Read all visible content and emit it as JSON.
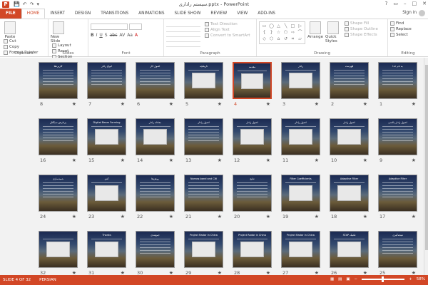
{
  "window": {
    "app_icon_letter": "P",
    "title": "سیستم راداری.pptx - PowerPoint",
    "controls": [
      "?",
      "▭",
      "–",
      "□",
      "✕"
    ]
  },
  "qat": [
    "💾",
    "↶",
    "↷",
    "▾"
  ],
  "tabs": [
    {
      "label": "FILE",
      "kind": "file"
    },
    {
      "label": "HOME",
      "kind": "active"
    },
    {
      "label": "INSERT"
    },
    {
      "label": "DESIGN"
    },
    {
      "label": "TRANSITIONS"
    },
    {
      "label": "ANIMATIONS"
    },
    {
      "label": "SLIDE SHOW"
    },
    {
      "label": "REVIEW"
    },
    {
      "label": "VIEW"
    },
    {
      "label": "ADD-INS"
    }
  ],
  "signin": "Sign in",
  "ribbon": {
    "clipboard": {
      "label": "Clipboard",
      "paste": "Paste",
      "cut": "Cut",
      "copy": "Copy",
      "format_painter": "Format Painter"
    },
    "slides": {
      "label": "Slides",
      "new_slide": "New Slide",
      "layout": "Layout",
      "reset": "Reset",
      "section": "Section"
    },
    "font": {
      "label": "Font",
      "format_glyphs": [
        "B",
        "I",
        "U",
        "S",
        "abc",
        "AV",
        "Aa",
        "A"
      ]
    },
    "paragraph": {
      "label": "Paragraph",
      "text_direction": "Text Direction",
      "align_text": "Align Text",
      "convert_smartart": "Convert to SmartArt"
    },
    "drawing": {
      "label": "Drawing",
      "arrange": "Arrange",
      "quick_styles": "Quick Styles",
      "shape_fill": "Shape Fill",
      "shape_outline": "Shape Outline",
      "shape_effects": "Shape Effects",
      "shapes": [
        "▭",
        "◯",
        "△",
        "╲",
        "□",
        "▷",
        "{",
        "}",
        "☆",
        "⬠",
        "⇨",
        "⌒",
        "◇",
        "⬡",
        "⌂",
        "↺",
        "⌗",
        "▱"
      ]
    },
    "editing": {
      "label": "Editing",
      "find": "Find",
      "replace": "Replace",
      "select": "Select"
    }
  },
  "slides": [
    {
      "n": 1,
      "title": "به نام خدا"
    },
    {
      "n": 2,
      "title": "فهرست"
    },
    {
      "n": 3,
      "title": "رادار",
      "pic": true
    },
    {
      "n": 4,
      "title": "مقدمه",
      "pic": true,
      "selected": true
    },
    {
      "n": 5,
      "title": "تاریخچه",
      "pic": true
    },
    {
      "n": 6,
      "title": "اصول کار"
    },
    {
      "n": 7,
      "title": "انواع رادار"
    },
    {
      "n": 8,
      "title": "کاربردها"
    },
    {
      "n": 9,
      "title": "اصول رادار پالسی"
    },
    {
      "n": 10,
      "title": "اصول رادار",
      "pic": true
    },
    {
      "n": 11,
      "title": "اصول رادار",
      "pic": true
    },
    {
      "n": 12,
      "title": "اصول رادار",
      "pic": true
    },
    {
      "n": 13,
      "title": "اصول رادار"
    },
    {
      "n": 14,
      "title": "معادله رادار",
      "pic": true
    },
    {
      "n": 15,
      "title": "Digital Beam Forming",
      "pic": true
    },
    {
      "n": 16,
      "title": "پردازش سیگنال"
    },
    {
      "n": 17,
      "title": "Adaptive Filter"
    },
    {
      "n": 18,
      "title": "Adaptive Filter",
      "pic": true
    },
    {
      "n": 19,
      "title": "Filter Coefficients",
      "pic": true
    },
    {
      "n": 20,
      "title": "نتایج"
    },
    {
      "n": 21,
      "title": "Narrow-band and CW"
    },
    {
      "n": 22,
      "title": "روش‌ها"
    },
    {
      "n": 23,
      "title": "آنتن",
      "pic": true
    },
    {
      "n": 24,
      "title": "شبیه‌سازی"
    },
    {
      "n": 25,
      "title": "نتیجه‌گیری"
    },
    {
      "n": 26,
      "title": "تکنیک STAP",
      "pic": true
    },
    {
      "n": 27,
      "title": "Project Radar in China",
      "pic": true
    },
    {
      "n": 28,
      "title": "Project Radar in China",
      "pic": true
    },
    {
      "n": 29,
      "title": "Project Radar in China",
      "pic": true
    },
    {
      "n": 30,
      "title": "جمع‌بندی"
    },
    {
      "n": 31,
      "title": "Thanks",
      "pic": true
    },
    {
      "n": 32,
      "title": "",
      "pic": true
    }
  ],
  "star_glyph": "★",
  "status": {
    "slide_of": "SLIDE 4 OF 32",
    "language": "PERSIAN",
    "zoom": "58%",
    "icons": [
      "▦",
      "▤",
      "▣",
      "−",
      "+"
    ]
  }
}
